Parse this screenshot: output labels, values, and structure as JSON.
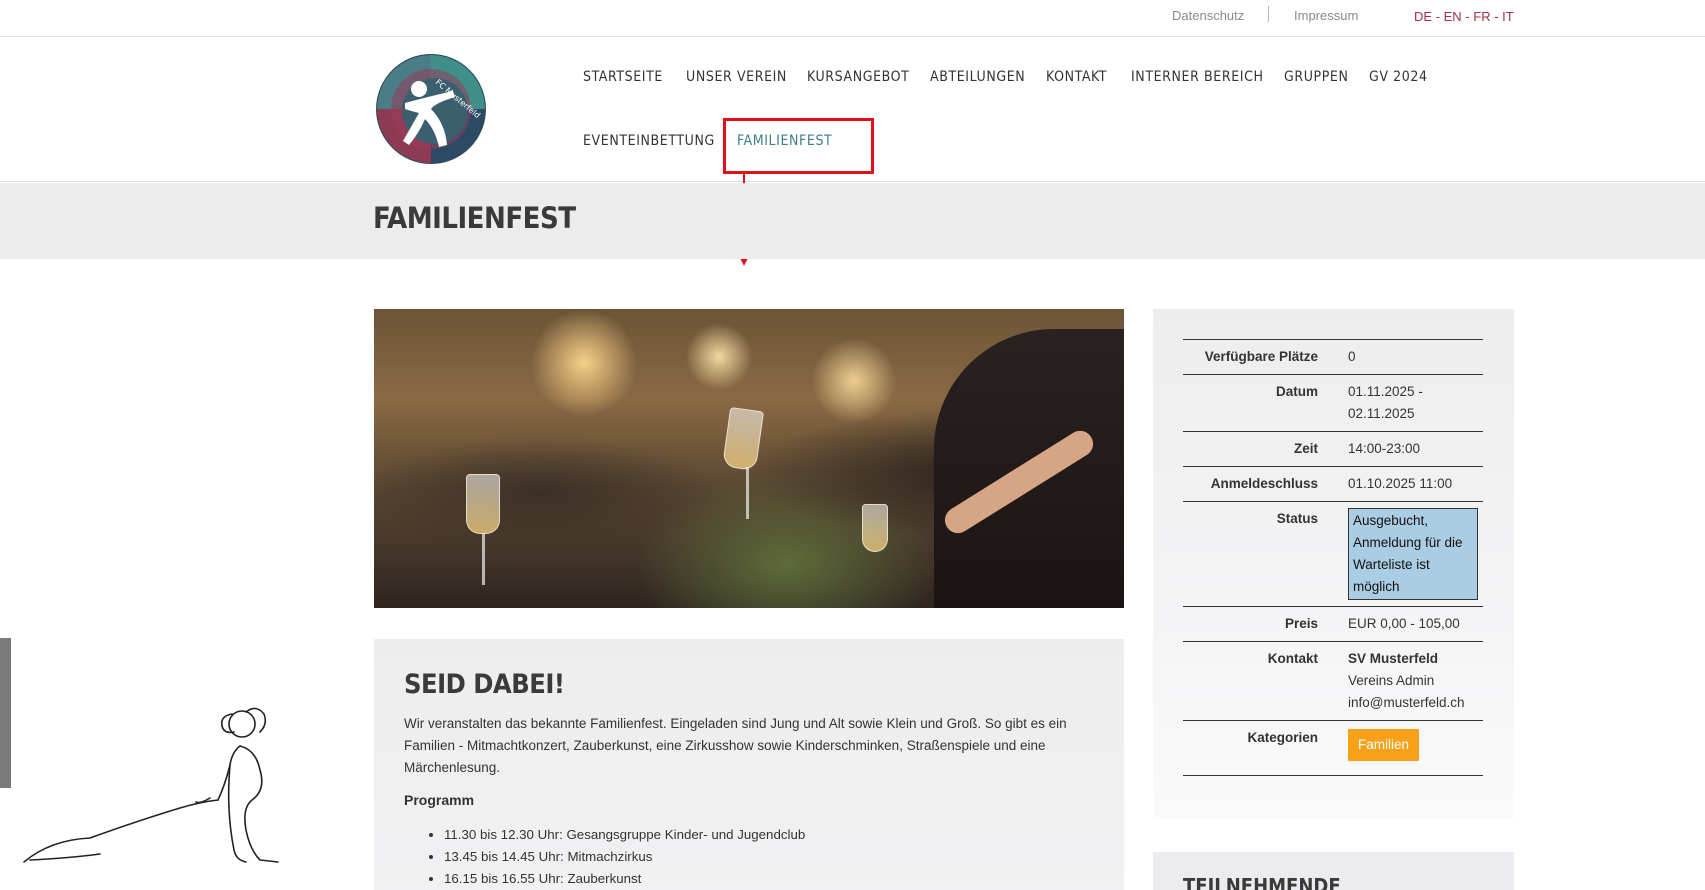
{
  "topbar": {
    "privacy_link": "Datenschutz",
    "imprint_link": "Impressum",
    "languages": [
      "DE",
      "EN",
      "FR",
      "IT"
    ],
    "language_separator": " - "
  },
  "logo": {
    "text": "FC Musterfeld"
  },
  "nav": {
    "items": [
      {
        "label": "STARTSEITE"
      },
      {
        "label": "UNSER VEREIN"
      },
      {
        "label": "KURSANGEBOT"
      },
      {
        "label": "ABTEILUNGEN"
      },
      {
        "label": "KONTAKT"
      },
      {
        "label": "INTERNER BEREICH"
      },
      {
        "label": "GRUPPEN"
      },
      {
        "label": "GV 2024"
      },
      {
        "label": "EVENTEINBETTUNG"
      },
      {
        "label": "FAMILIENFEST"
      }
    ],
    "active": "FAMILIENFEST"
  },
  "page": {
    "title": "FAMILIENFEST"
  },
  "content": {
    "heading": "SEID DABEI!",
    "intro": "Wir veranstalten das bekannte Familienfest. Eingeladen sind Jung und Alt sowie Klein und Groß. So gibt es ein Familien - Mitmachtkonzert, Zauberkunst, eine Zirkusshow sowie Kinderschminken, Straßenspiele und eine Märchenlesung.",
    "program_title": "Programm",
    "program": [
      "11.30 bis 12.30 Uhr: Gesangsgruppe Kinder- und Jugendclub",
      "13.45 bis 14.45 Uhr: Mitmachzirkus",
      "16.15 bis 16.55 Uhr: Zauberkunst"
    ]
  },
  "info": {
    "seats_label": "Verfügbare Plätze",
    "seats_value": "0",
    "date_label": "Datum",
    "date_value_1": "01.11.2025 -",
    "date_value_2": "02.11.2025",
    "time_label": "Zeit",
    "time_value": "14:00-23:00",
    "deadline_label": "Anmeldeschluss",
    "deadline_value": "01.10.2025 11:00",
    "status_label": "Status",
    "status_value": "Ausgebucht, Anmeldung für die Warteliste ist möglich",
    "price_label": "Preis",
    "price_value": "EUR 0,00 - 105,00",
    "contact_label": "Kontakt",
    "contact_org": "SV Musterfeld",
    "contact_person": "Vereins Admin",
    "contact_email": "info@musterfeld.ch",
    "categories_label": "Kategorien",
    "category_tag": "Familien"
  },
  "sidebar2": {
    "title": "TEILNEHMENDE"
  },
  "colors": {
    "accent_teal": "#3d7f86",
    "language_red": "#a0304a",
    "status_blue": "#abcde3",
    "tag_orange": "#f7a11a",
    "highlight_red": "#e0101a"
  }
}
